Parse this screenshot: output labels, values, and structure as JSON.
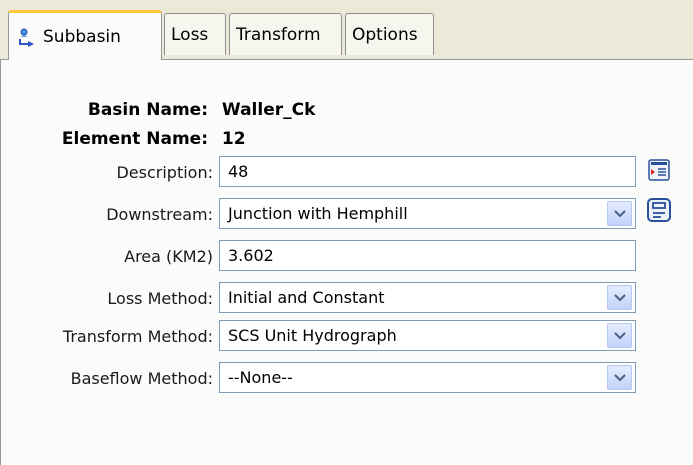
{
  "tabs": [
    {
      "label": "Subbasin",
      "icon": "subbasin-icon",
      "active": true
    },
    {
      "label": "Loss",
      "active": false
    },
    {
      "label": "Transform",
      "active": false
    },
    {
      "label": "Options",
      "active": false
    }
  ],
  "header": {
    "basin_label": "Basin Name:",
    "basin_value": "Waller_Ck",
    "element_label": "Element Name:",
    "element_value": "12"
  },
  "fields": {
    "description": {
      "label": "Description:",
      "value": "48"
    },
    "downstream": {
      "label": "Downstream:",
      "value": "Junction with Hemphill"
    },
    "area": {
      "label": "Area (KM2)",
      "value": "3.602"
    },
    "loss_method": {
      "label": "Loss Method:",
      "value": "Initial and Constant"
    },
    "transform_method": {
      "label": "Transform Method:",
      "value": "SCS Unit Hydrograph"
    },
    "baseflow_method": {
      "label": "Baseflow Method:",
      "value": "--None--"
    }
  },
  "icons": {
    "description_button": "description-editor-icon",
    "downstream_button": "element-selector-icon"
  },
  "colors": {
    "active_tab_accent": "#ffc83c",
    "field_border": "#7f9db9",
    "panel_bg": "#fbfbf9",
    "tabstrip_bg": "#ece9d8"
  }
}
